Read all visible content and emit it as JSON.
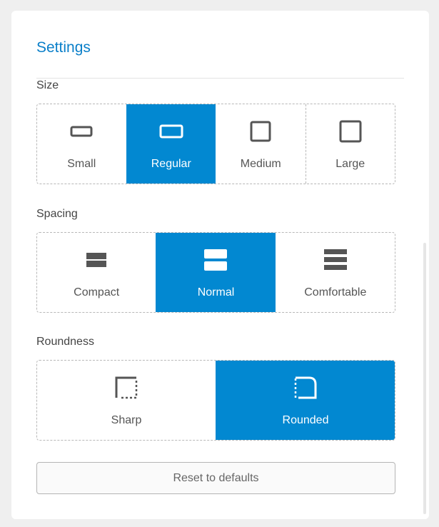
{
  "panel": {
    "title": "Settings"
  },
  "size": {
    "label": "Size",
    "options": [
      {
        "label": "Small",
        "icon": "small-rect-icon",
        "selected": false
      },
      {
        "label": "Regular",
        "icon": "regular-rect-icon",
        "selected": true
      },
      {
        "label": "Medium",
        "icon": "medium-square-icon",
        "selected": false
      },
      {
        "label": "Large",
        "icon": "large-square-icon",
        "selected": false
      }
    ]
  },
  "spacing": {
    "label": "Spacing",
    "options": [
      {
        "label": "Compact",
        "icon": "compact-rows-icon",
        "selected": false
      },
      {
        "label": "Normal",
        "icon": "normal-rows-icon",
        "selected": true
      },
      {
        "label": "Comfortable",
        "icon": "comfortable-rows-icon",
        "selected": false
      }
    ]
  },
  "roundness": {
    "label": "Roundness",
    "options": [
      {
        "label": "Sharp",
        "icon": "sharp-corner-icon",
        "selected": false
      },
      {
        "label": "Rounded",
        "icon": "rounded-corner-icon",
        "selected": true
      }
    ]
  },
  "reset": {
    "label": "Reset to defaults"
  },
  "colors": {
    "accent": "#0288d1",
    "title": "#0a7fc9"
  }
}
